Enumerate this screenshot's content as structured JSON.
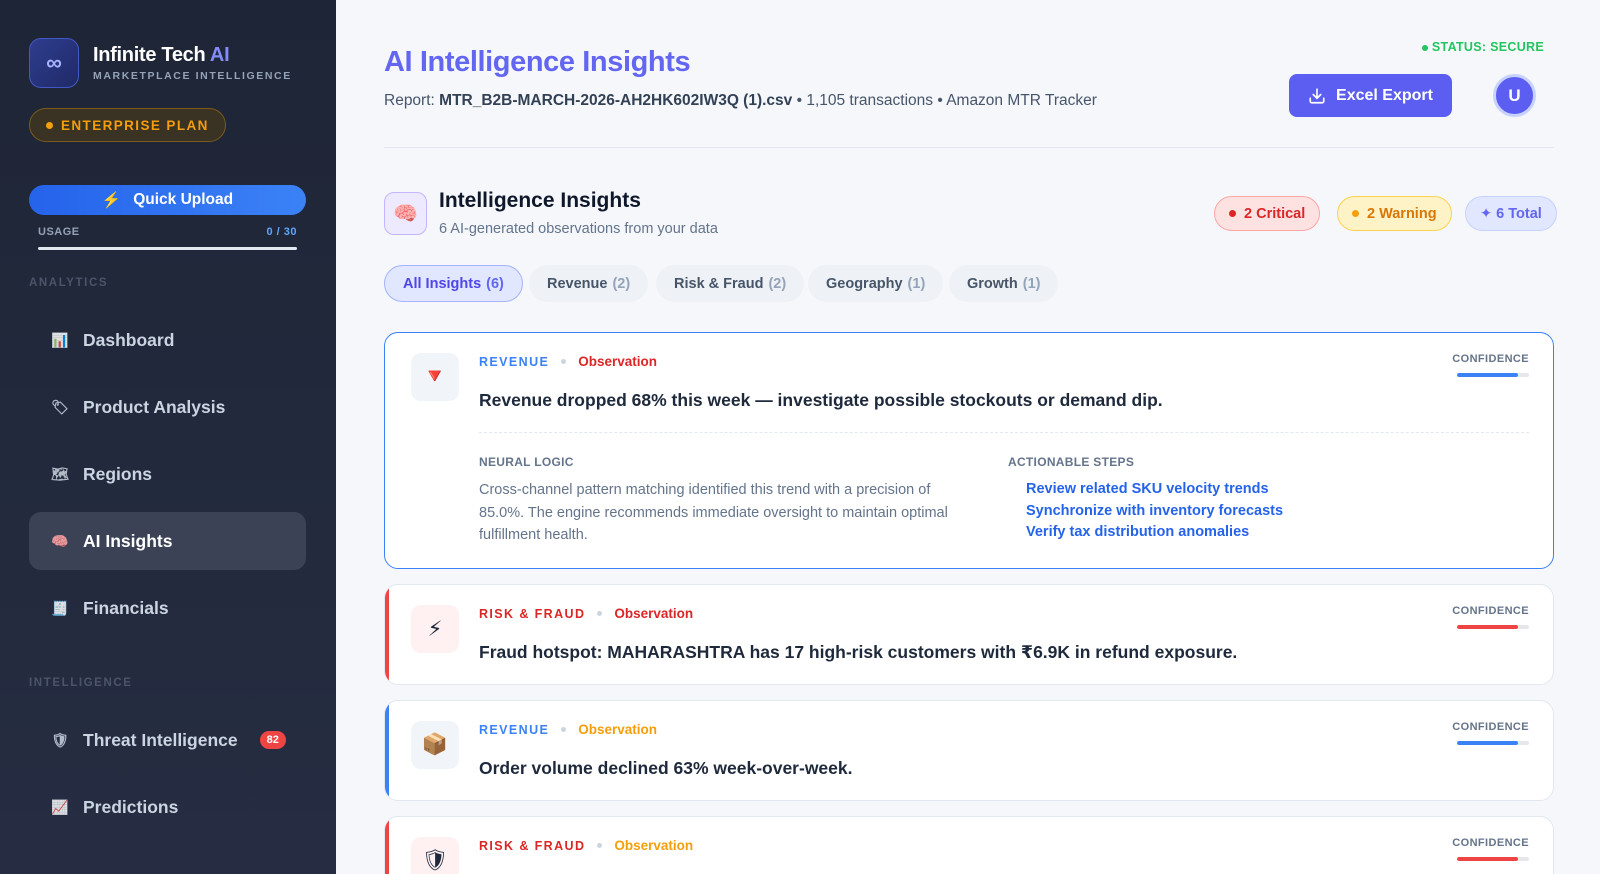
{
  "sidebar": {
    "brand": {
      "name": "Infinite Tech",
      "name_ai": "AI",
      "subtitle": "MARKETPLACE INTELLIGENCE",
      "logo_glyph": "∞"
    },
    "plan_badge": "ENTERPRISE PLAN",
    "quick_upload": "Quick Upload",
    "usage": {
      "label": "USAGE",
      "value": "0 / 30",
      "fraction": 0
    },
    "sections": {
      "analytics": "ANALYTICS",
      "intelligence": "INTELLIGENCE"
    },
    "items": [
      {
        "label": "Dashboard",
        "icon": "bar-chart-icon",
        "glyph": "📊",
        "active": false
      },
      {
        "label": "Product Analysis",
        "icon": "tag-icon",
        "glyph": "🏷",
        "active": false
      },
      {
        "label": "Regions",
        "icon": "map-icon",
        "glyph": "🗺",
        "active": false
      },
      {
        "label": "AI Insights",
        "icon": "brain-icon",
        "glyph": "🧠",
        "active": true
      },
      {
        "label": "Financials",
        "icon": "receipt-icon",
        "glyph": "🧾",
        "active": false
      },
      {
        "label": "Threat Intelligence",
        "icon": "shield-icon",
        "glyph": "🛡",
        "active": false,
        "badge": "82"
      },
      {
        "label": "Predictions",
        "icon": "trend-chart-icon",
        "glyph": "📈",
        "active": false
      }
    ]
  },
  "header": {
    "title": "AI Intelligence Insights",
    "report_prefix": "Report:",
    "report_file": "MTR_B2B-MARCH-2026-AH2HK602IW3Q (1).csv",
    "report_suffix": "• 1,105 transactions • Amazon MTR Tracker",
    "status": "STATUS: SECURE",
    "export_label": "Excel Export",
    "avatar_initial": "U"
  },
  "insights": {
    "title": "Intelligence Insights",
    "subtitle": "6 AI-generated observations from your data",
    "critical": "2 Critical",
    "warning": "2 Warning",
    "total": "✦ 6 Total"
  },
  "tabs": [
    {
      "label": "All Insights",
      "count": "(6)",
      "active": true
    },
    {
      "label": "Revenue",
      "count": "(2)",
      "active": false
    },
    {
      "label": "Risk & Fraud",
      "count": "(2)",
      "active": false
    },
    {
      "label": "Geography",
      "count": "(1)",
      "active": false
    },
    {
      "label": "Growth",
      "count": "(1)",
      "active": false
    }
  ],
  "cards": [
    {
      "category": "REVENUE",
      "kind": "Observation",
      "text": "Revenue dropped 68% this week — investigate possible stockouts or demand dip.",
      "icon": "down-triangle-icon",
      "glyph": "🔻",
      "confidence_label": "CONFIDENCE",
      "confidence": 0.85,
      "cat_color": "#3b82f6",
      "kind_color": "#dc2626",
      "bar_color": "#3b82f6",
      "logic_label": "NEURAL LOGIC",
      "logic_text": "Cross-channel pattern matching identified this trend with a precision of 85.0%. The engine recommends immediate oversight to maintain optimal fulfillment health.",
      "steps_label": "ACTIONABLE STEPS",
      "steps": [
        "Review related SKU velocity trends",
        "Synchronize with inventory forecasts",
        "Verify tax distribution anomalies"
      ]
    },
    {
      "category": "RISK & FRAUD",
      "kind": "Observation",
      "text": "Fraud hotspot: MAHARASHTRA has 17 high-risk customers with ₹6.9K in refund exposure.",
      "icon": "lightning-icon",
      "glyph": "⚡",
      "confidence_label": "CONFIDENCE",
      "confidence": 0.85,
      "cat_color": "#dc2626",
      "kind_color": "#dc2626",
      "bar_color": "#ef4444"
    },
    {
      "category": "REVENUE",
      "kind": "Observation",
      "text": "Order volume declined 63% week-over-week.",
      "icon": "package-icon",
      "glyph": "📦",
      "confidence_label": "CONFIDENCE",
      "confidence": 0.85,
      "cat_color": "#3b82f6",
      "kind_color": "#f59e0b",
      "bar_color": "#3b82f6"
    },
    {
      "category": "RISK & FRAUD",
      "kind": "Observation",
      "text": "",
      "icon": "shield-icon",
      "glyph": "🛡",
      "confidence_label": "CONFIDENCE",
      "confidence": 0.85,
      "cat_color": "#dc2626",
      "kind_color": "#f59e0b",
      "bar_color": "#ef4444"
    }
  ],
  "colors": {
    "accent": "#6366f1",
    "primary_button": "#5b5ef0",
    "critical": "#dc2626",
    "warning": "#f59e0b",
    "success": "#22c55e",
    "link": "#2563eb"
  }
}
